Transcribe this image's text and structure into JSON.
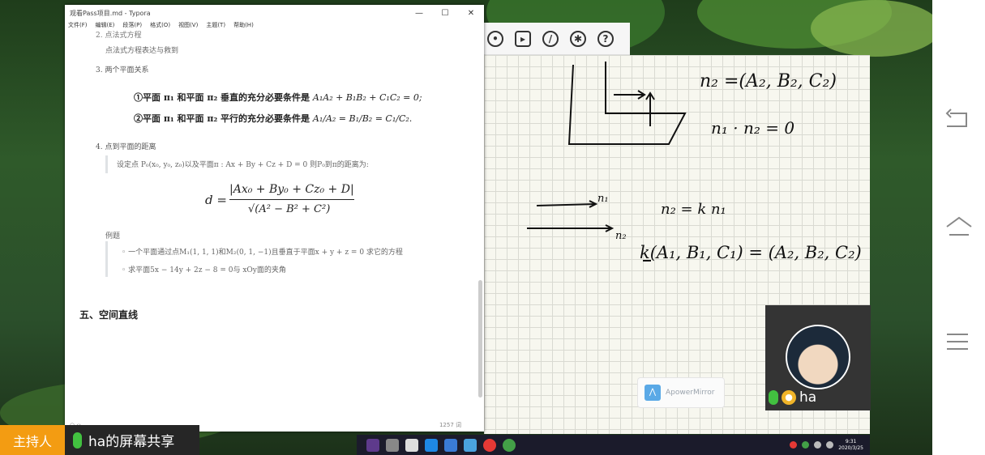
{
  "typora": {
    "title": "观看Pass项目.md - Typora",
    "menu": [
      "文件(F)",
      "编辑(E)",
      "段落(P)",
      "格式(O)",
      "视图(V)",
      "主题(T)",
      "帮助(H)"
    ],
    "controls": [
      "—",
      "☐",
      "✕"
    ],
    "lines": {
      "prev_heading_cut": "2.  点法式方程",
      "point_normal": "点法式方程表达与救到",
      "two_planes": "3. 两个平面关系",
      "perp_prefix": "①平面 π₁ 和平面 π₂ 垂直的充分必要条件是 ",
      "perp_formula": "A₁A₂ + B₁B₂ + C₁C₂ = 0;",
      "para_prefix": "②平面 π₁ 和平面 π₂ 平行的充分必要条件是 ",
      "para_formula": "A₁/A₂ = B₁/B₂ = C₁/C₂.",
      "distance": "4. 点到平面的距离",
      "given": "设定点  P₀(x₀, y₀, z₀)以及平面π : Ax + By + Cz + D = 0  则P₀到π的距离为:",
      "d_lhs": "d =",
      "numerator": "|Ax₀ + By₀ + Cz₀ + D|",
      "denominator": "√(A² − B² + C²)",
      "example": "例题",
      "ex1": "一个平面通过点M₁(1, 1, 1)和M₂(0, 1, −1)且垂直于平面x + y + z = 0 求它的方程",
      "ex2": "求平面5x − 14y + 2z − 8 = 0与 xOy面的夹角",
      "section5": "五、空间直线"
    },
    "status_right": "1257 词"
  },
  "whiteboard": {
    "handwriting": {
      "n2_def": "n₂ =(A₂, B₂, C₂)",
      "dot_zero": "n₁ · n₂ = 0",
      "n1": "n₁",
      "n2_eq": "n₂ = k n₁",
      "n2": "n₂",
      "k_eq": "k(A₁, B₁, C₁) = (A₂, B₂, C₂)"
    },
    "watermark": "ApowerMirror"
  },
  "webcam": {
    "name": "ha"
  },
  "bottom": {
    "host": "主持人",
    "share": "ha的屏幕共享"
  },
  "taskbar": {
    "time": "9:31",
    "date": "2020/3/25"
  },
  "colors": {
    "host_bg": "#f39c12",
    "mic_green": "#42c140"
  },
  "icons": [
    "camera-icon",
    "video-icon",
    "brush-icon",
    "gear-icon",
    "help-icon",
    "back-icon",
    "home-icon",
    "menu-icon",
    "mic-icon",
    "person-icon"
  ]
}
